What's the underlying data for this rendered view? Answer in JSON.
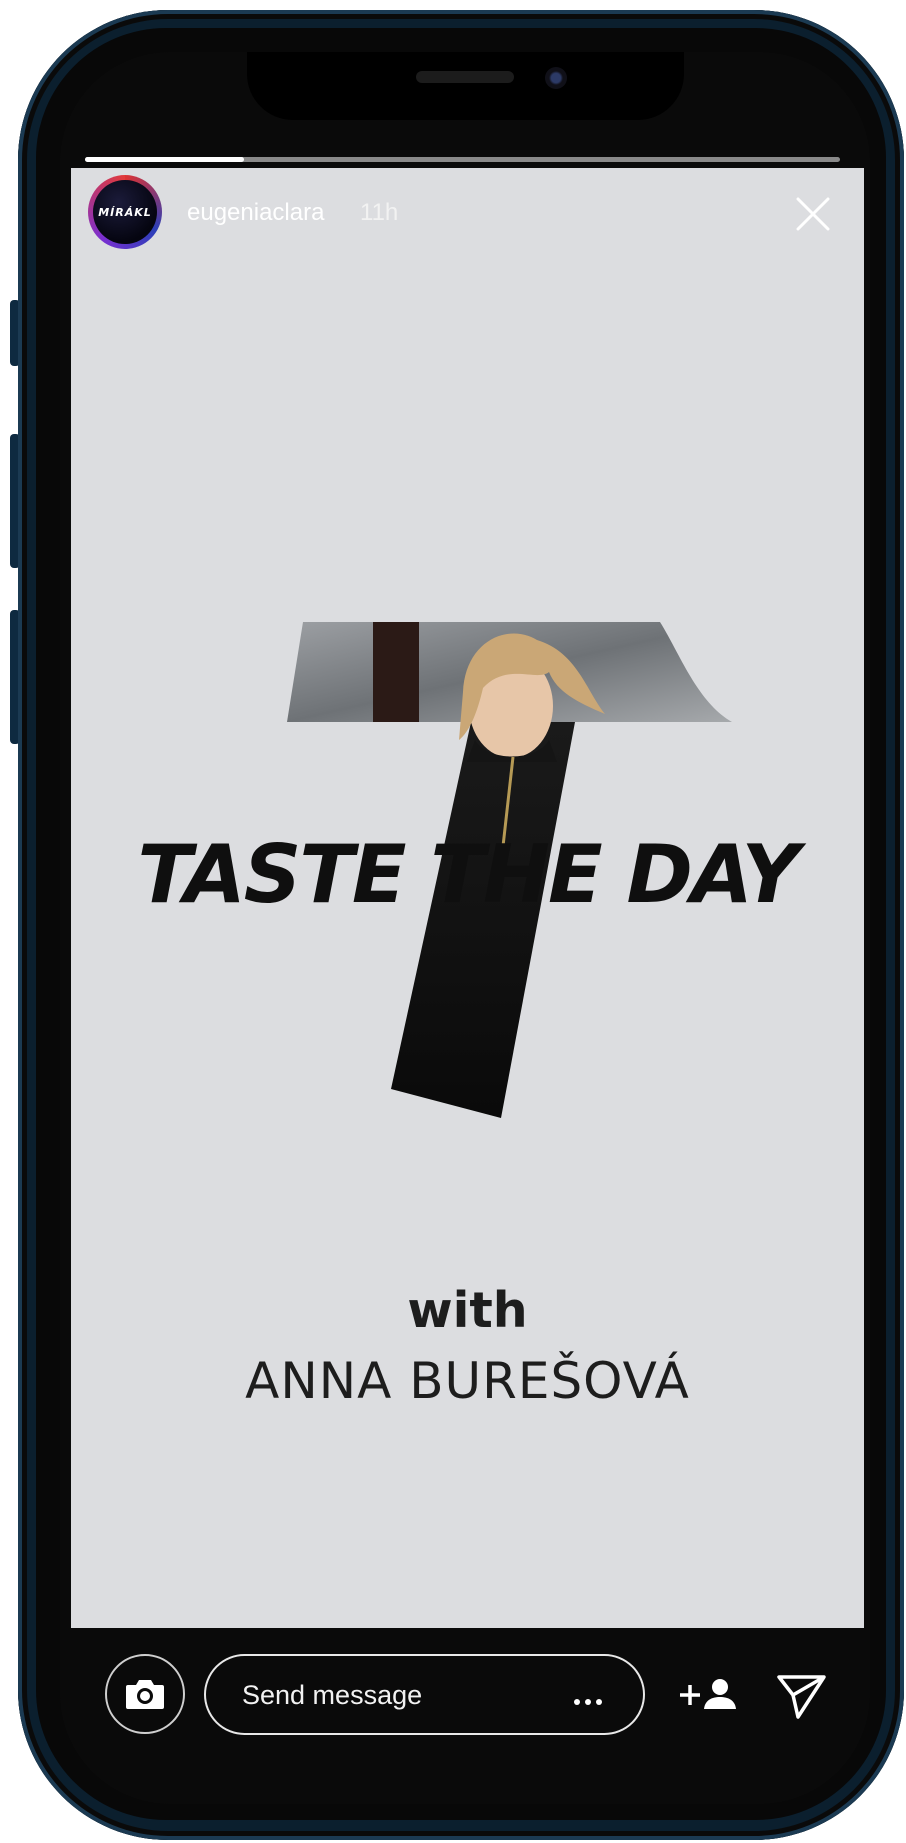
{
  "story": {
    "progress_fraction": 0.21,
    "author": {
      "username": "eugeniaclara",
      "time": "11h",
      "avatar_logo_text": "MÍRÁKL"
    },
    "content": {
      "headline": "TASTE THE DAY",
      "with": "with",
      "name": "ANNA BUREŠOVÁ",
      "background_color": "#dcdde0"
    }
  },
  "bottom_bar": {
    "message_placeholder": "Send message"
  },
  "icons": {
    "close": "close-icon",
    "camera": "camera-icon",
    "more": "more-icon",
    "add_person": "add-person-icon",
    "send": "send-icon"
  }
}
